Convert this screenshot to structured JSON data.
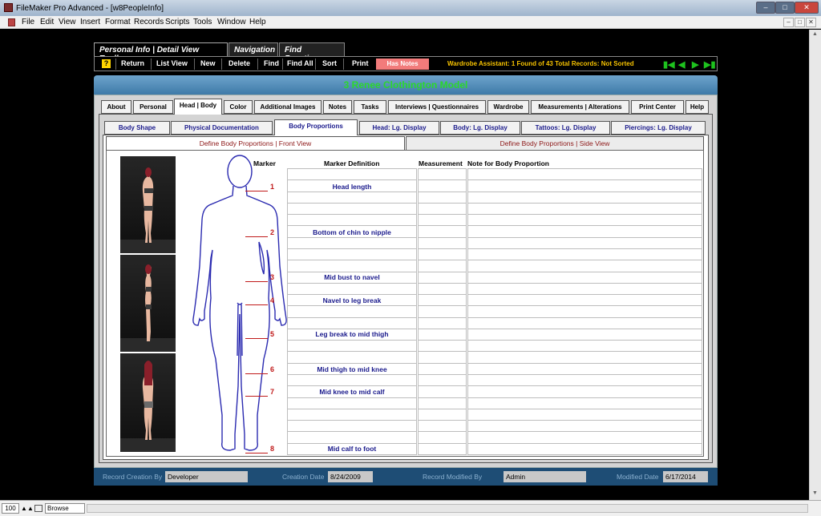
{
  "window": {
    "title": "FileMaker Pro Advanced - [w8PeopleInfo]"
  },
  "menu": [
    "File",
    "Edit",
    "View",
    "Insert",
    "Format",
    "Records",
    "Scripts",
    "Tools",
    "Window",
    "Help"
  ],
  "toolbar_tabs": [
    "Personal Info | Detail View Toolbar",
    "Navigation",
    "Find Functions"
  ],
  "toolbar": {
    "help_glyph": "?",
    "buttons": [
      "Return",
      "List View",
      "New",
      "Delete",
      "Find",
      "Find All",
      "Sort",
      "Print"
    ],
    "has_notes": "Has Notes",
    "wardrobe_status": "Wardrobe Assistant:  1 Found of 43 Total Records: Not Sorted"
  },
  "record_title": "3    Renee Clothington    Model",
  "main_tabs": [
    "About",
    "Personal",
    "Head | Body",
    "Color",
    "Additional Images",
    "Notes",
    "Tasks",
    "Interviews | Questionnaires",
    "Wardrobe",
    "Measurements | Alterations",
    "Print Center",
    "Help"
  ],
  "sub_tabs": [
    "Body Shape",
    "Physical Documentation",
    "Body Proportions",
    "Head: Lg. Display",
    "Body: Lg. Display",
    "Tattoos: Lg. Display",
    "Piercings: Lg. Display"
  ],
  "view_tabs": [
    "Define Body Proportions | Front View",
    "Define Body Proportions | Side View"
  ],
  "columns": {
    "marker": "Marker",
    "definition": "Marker Definition",
    "measurement": "Measurement",
    "note": "Note for Body Proportion"
  },
  "markers": [
    {
      "number": "1",
      "definition": "Head length"
    },
    {
      "number": "2",
      "definition": "Bottom of chin to nipple"
    },
    {
      "number": "3",
      "definition": "Mid bust to navel"
    },
    {
      "number": "4",
      "definition": "Navel to leg break"
    },
    {
      "number": "5",
      "definition": "Leg break to mid thigh"
    },
    {
      "number": "6",
      "definition": "Mid thigh to mid knee"
    },
    {
      "number": "7",
      "definition": "Mid knee to mid calf"
    },
    {
      "number": "8",
      "definition": "Mid calf to foot"
    }
  ],
  "footer": {
    "created_by_label": "Record Creation By",
    "created_by": "Developer",
    "creation_date_label": "Creation Date",
    "creation_date": "8/24/2009",
    "modified_by_label": "Record Modified By",
    "modified_by": "Admin",
    "modified_date_label": "Modified Date",
    "modified_date": "6/17/2014"
  },
  "status": {
    "zoom": "100",
    "mode": "Browse"
  },
  "colors": {
    "record_title": "#2bd82b",
    "header": "#4a86b4",
    "has_notes": "#f27b7b",
    "wardrobe_text": "#f7c300",
    "nav_arrows": "#1ec21e",
    "marker": "#c01a1a",
    "definition_text": "#1a1a8c"
  }
}
